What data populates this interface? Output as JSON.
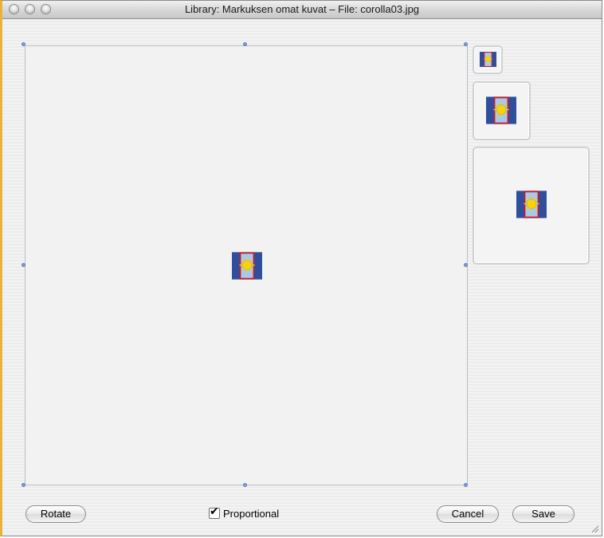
{
  "window": {
    "title": "Library: Markuksen omat kuvat – File: corolla03.jpg"
  },
  "controls": {
    "rotate_label": "Rotate",
    "proportional_label": "Proportional",
    "proportional_checked": true,
    "cancel_label": "Cancel",
    "save_label": "Save"
  },
  "colors": {
    "logo_blue": "#2f4f9c",
    "logo_red": "#c0202c",
    "logo_yellow": "#f7d30f",
    "handle": "#7d9fd3",
    "window_accent": "#e7b33a"
  },
  "icons": {
    "image": "sun-moon-logo",
    "check": "checkmark"
  }
}
